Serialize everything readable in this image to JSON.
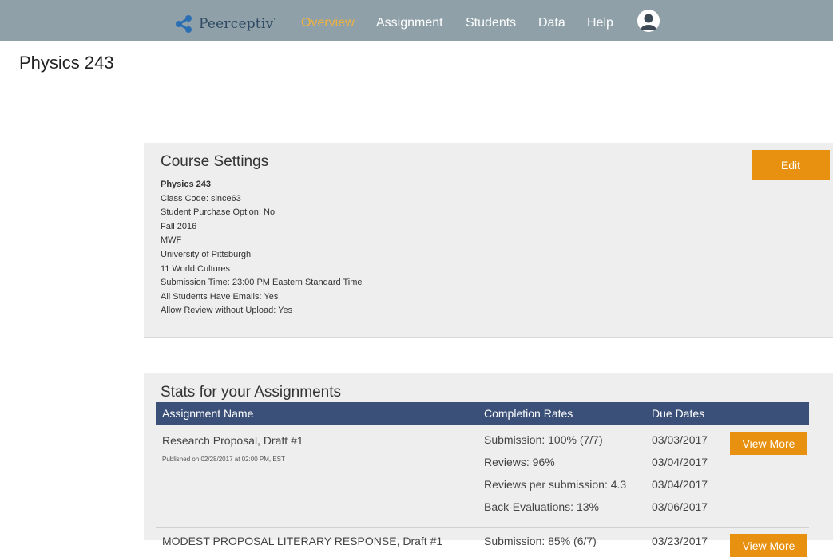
{
  "nav": {
    "brand": "Peerceptiv",
    "brand_mark": "'",
    "items": [
      {
        "label": "Overview",
        "active": true
      },
      {
        "label": "Assignment",
        "active": false
      },
      {
        "label": "Students",
        "active": false
      },
      {
        "label": "Data",
        "active": false
      },
      {
        "label": "Help",
        "active": false
      }
    ],
    "avatar_icon": "user-icon"
  },
  "page": {
    "title": "Physics 243"
  },
  "course_settings": {
    "title": "Course Settings",
    "edit_label": "Edit",
    "lines": [
      "Physics 243",
      "Class Code: since63",
      "Student Purchase Option: No",
      "Fall 2016",
      "MWF",
      "University of Pittsburgh",
      "11 World Cultures",
      "Submission Time: 23:00 PM Eastern Standard Time",
      "All Students Have Emails: Yes",
      "Allow Review without Upload: Yes"
    ]
  },
  "stats": {
    "title": "Stats for your Assignments",
    "columns": {
      "name": "Assignment Name",
      "completion": "Completion Rates",
      "due": "Due Dates"
    },
    "assignments": [
      {
        "name": "Research Proposal, Draft #1",
        "published": "Published on 02/28/2017 at 02:00 PM, EST",
        "rates": [
          {
            "label": "Submission: 100% (7/7)",
            "due": "03/03/2017"
          },
          {
            "label": "Reviews: 96%",
            "due": "03/04/2017"
          },
          {
            "label": "Reviews per submission: 4.3",
            "due": "03/04/2017"
          },
          {
            "label": "Back-Evaluations: 13%",
            "due": "03/06/2017"
          }
        ],
        "button": "View More"
      },
      {
        "name": "MODEST PROPOSAL LITERARY RESPONSE, Draft #1",
        "rates": [
          {
            "label": "Submission: 85% (6/7)",
            "due": "03/23/2017"
          }
        ],
        "button": "View More"
      }
    ]
  },
  "colors": {
    "nav_bg": "#8fa0a9",
    "nav_active": "#f2b33d",
    "accent_button": "#e8900f",
    "table_header": "#3b5078"
  }
}
